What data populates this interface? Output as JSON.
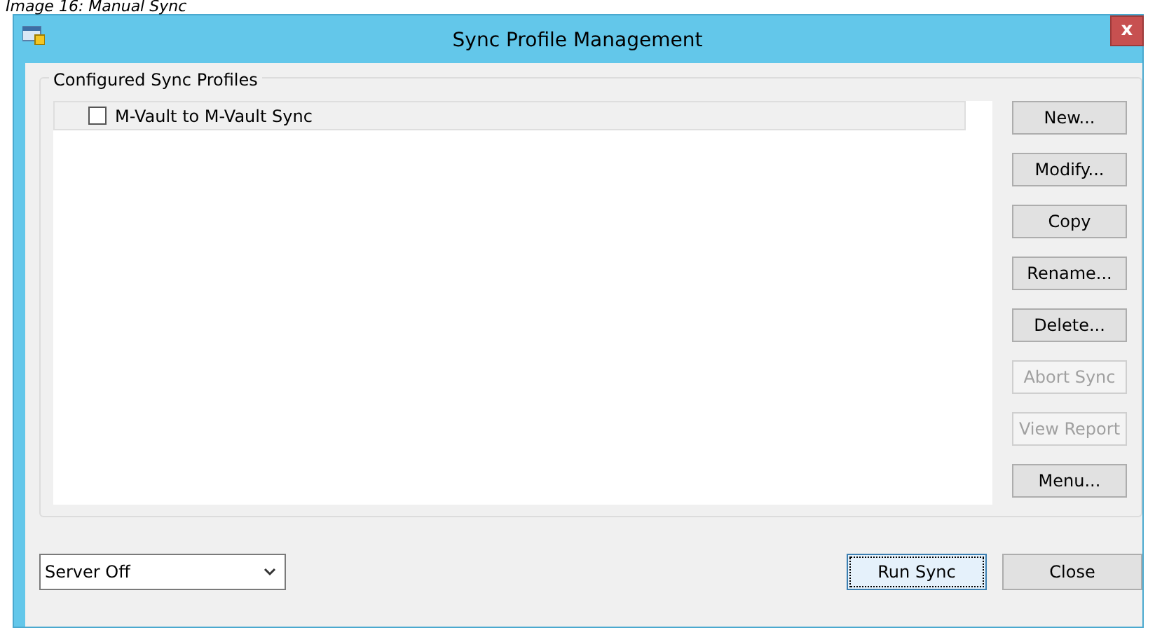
{
  "caption": "Image 16: Manual Sync",
  "window": {
    "title": "Sync Profile Management",
    "close": "x"
  },
  "group": {
    "label": "Configured Sync Profiles",
    "profiles": [
      {
        "name": "M-Vault to M-Vault Sync",
        "checked": false
      }
    ],
    "buttons": [
      {
        "label": "New...",
        "disabled": false
      },
      {
        "label": "Modify...",
        "disabled": false
      },
      {
        "label": "Copy",
        "disabled": false
      },
      {
        "label": "Rename...",
        "disabled": false
      },
      {
        "label": "Delete...",
        "disabled": false
      },
      {
        "label": "Abort Sync",
        "disabled": true
      },
      {
        "label": "View Report",
        "disabled": true
      },
      {
        "label": "Menu...",
        "disabled": false
      }
    ]
  },
  "server_mode": {
    "value": "Server Off"
  },
  "footer_buttons": [
    {
      "label": "Run Sync",
      "focused": true
    },
    {
      "label": "Close",
      "focused": false
    }
  ]
}
